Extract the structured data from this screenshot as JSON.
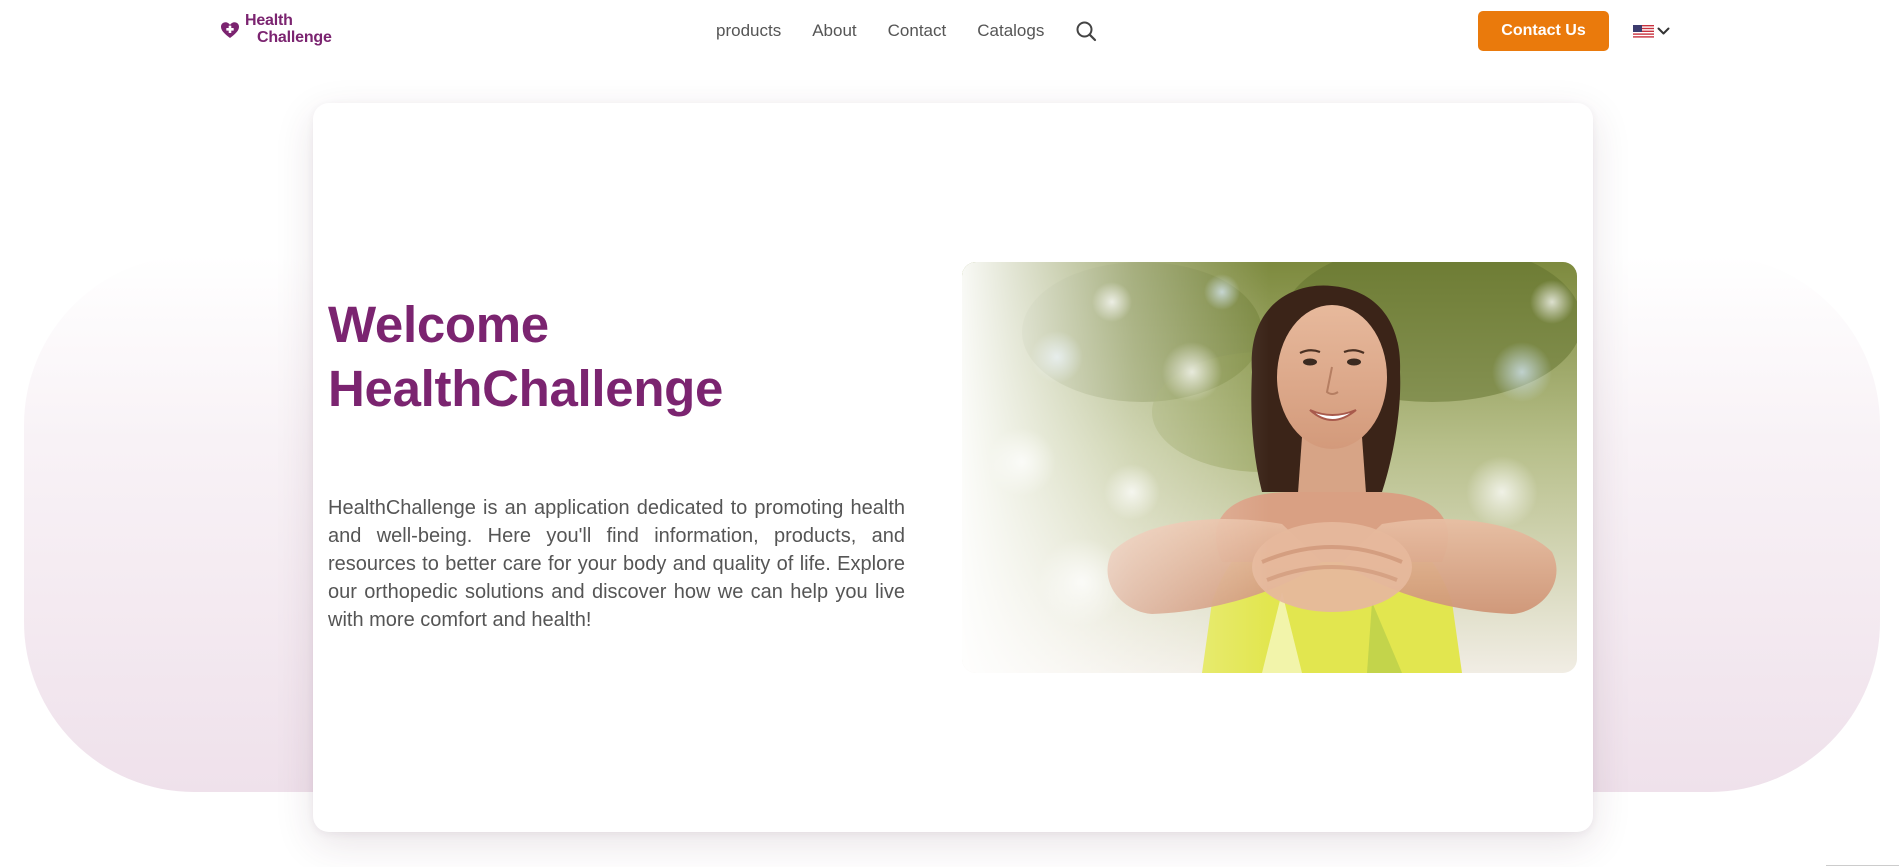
{
  "brand": {
    "name_line1": "Health",
    "name_line2": "Challenge",
    "color": "#7b2470",
    "icon": "heart-plus-icon"
  },
  "nav": {
    "items": [
      {
        "label": "products"
      },
      {
        "label": "About"
      },
      {
        "label": "Contact"
      },
      {
        "label": "Catalogs"
      }
    ],
    "search_icon": "search-icon"
  },
  "header": {
    "cta_label": "Contact Us",
    "cta_color": "#ea7a0c",
    "language": {
      "flag_icon": "us-flag-icon",
      "dropdown_icon": "chevron-down-icon"
    }
  },
  "hero": {
    "title_line1": "Welcome",
    "title_line2": "HealthChallenge",
    "description": "HealthChallenge is an application dedicated to promoting health and well-being. Here you'll find information, products, and resources to better care for your body and quality of life. Explore our orthopedic solutions and discover how we can help you live with more comfort and health!",
    "image": "smiling woman stretching arms with interlocked hands outdoors"
  }
}
